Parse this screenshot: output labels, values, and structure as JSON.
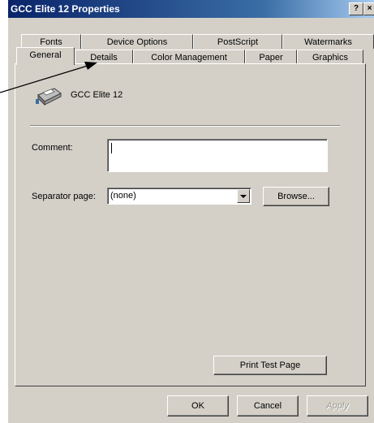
{
  "window": {
    "title": "GCC Elite 12 Properties",
    "help_button": "?",
    "close_button": "×"
  },
  "tabs": {
    "row_back": [
      "Fonts",
      "Device Options",
      "PostScript",
      "Watermarks"
    ],
    "row_front": [
      "General",
      "Details",
      "Color Management",
      "Paper",
      "Graphics"
    ],
    "active": "General"
  },
  "general": {
    "printer_name": "GCC Elite 12",
    "comment_label": "Comment:",
    "comment_value": "",
    "separator_label": "Separator page:",
    "separator_value": "(none)",
    "browse_button": "Browse...",
    "print_test_button": "Print Test Page"
  },
  "footer": {
    "ok_button": "OK",
    "cancel_button": "Cancel",
    "apply_button": "Apply"
  }
}
